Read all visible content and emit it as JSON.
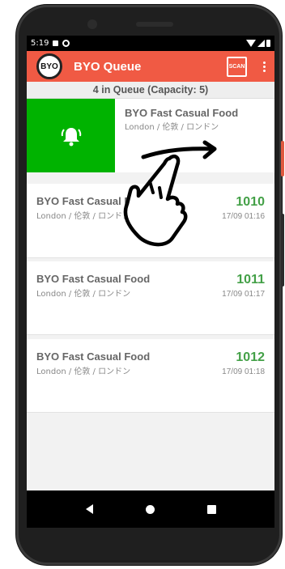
{
  "status_bar": {
    "time": "5:19",
    "icons": [
      "notification-icon",
      "sync-icon",
      "wifi-icon",
      "signal-icon",
      "battery-icon"
    ]
  },
  "app_bar": {
    "logo_text": "BYO",
    "title": "BYO Queue",
    "scan_icon": "scan-qr-icon",
    "scan_text": "SCAN",
    "menu_icon": "more-vert-icon",
    "color": "#f05a44"
  },
  "queue_summary": "4 in Queue (Capacity: 5)",
  "swiped_item": {
    "name": "BYO Fast Casual Food",
    "location": "London / 伦敦 / ロンドン",
    "action_icon": "bell-icon",
    "action_color": "#00b300"
  },
  "queue_items": [
    {
      "name": "BYO Fast Casual Food",
      "location": "London / 伦敦 / ロンドン",
      "number": "1010",
      "time": "17/09 01:16"
    },
    {
      "name": "BYO Fast Casual Food",
      "location": "London / 伦敦 / ロンドン",
      "number": "1011",
      "time": "17/09 01:17"
    },
    {
      "name": "BYO Fast Casual Food",
      "location": "London / 伦敦 / ロンドン",
      "number": "1012",
      "time": "17/09 01:18"
    }
  ],
  "number_color": "#43a047",
  "gesture_hint": "swipe-right-hand-icon",
  "nav_bar": {
    "icons": [
      "back-icon",
      "home-icon",
      "recents-icon"
    ]
  }
}
